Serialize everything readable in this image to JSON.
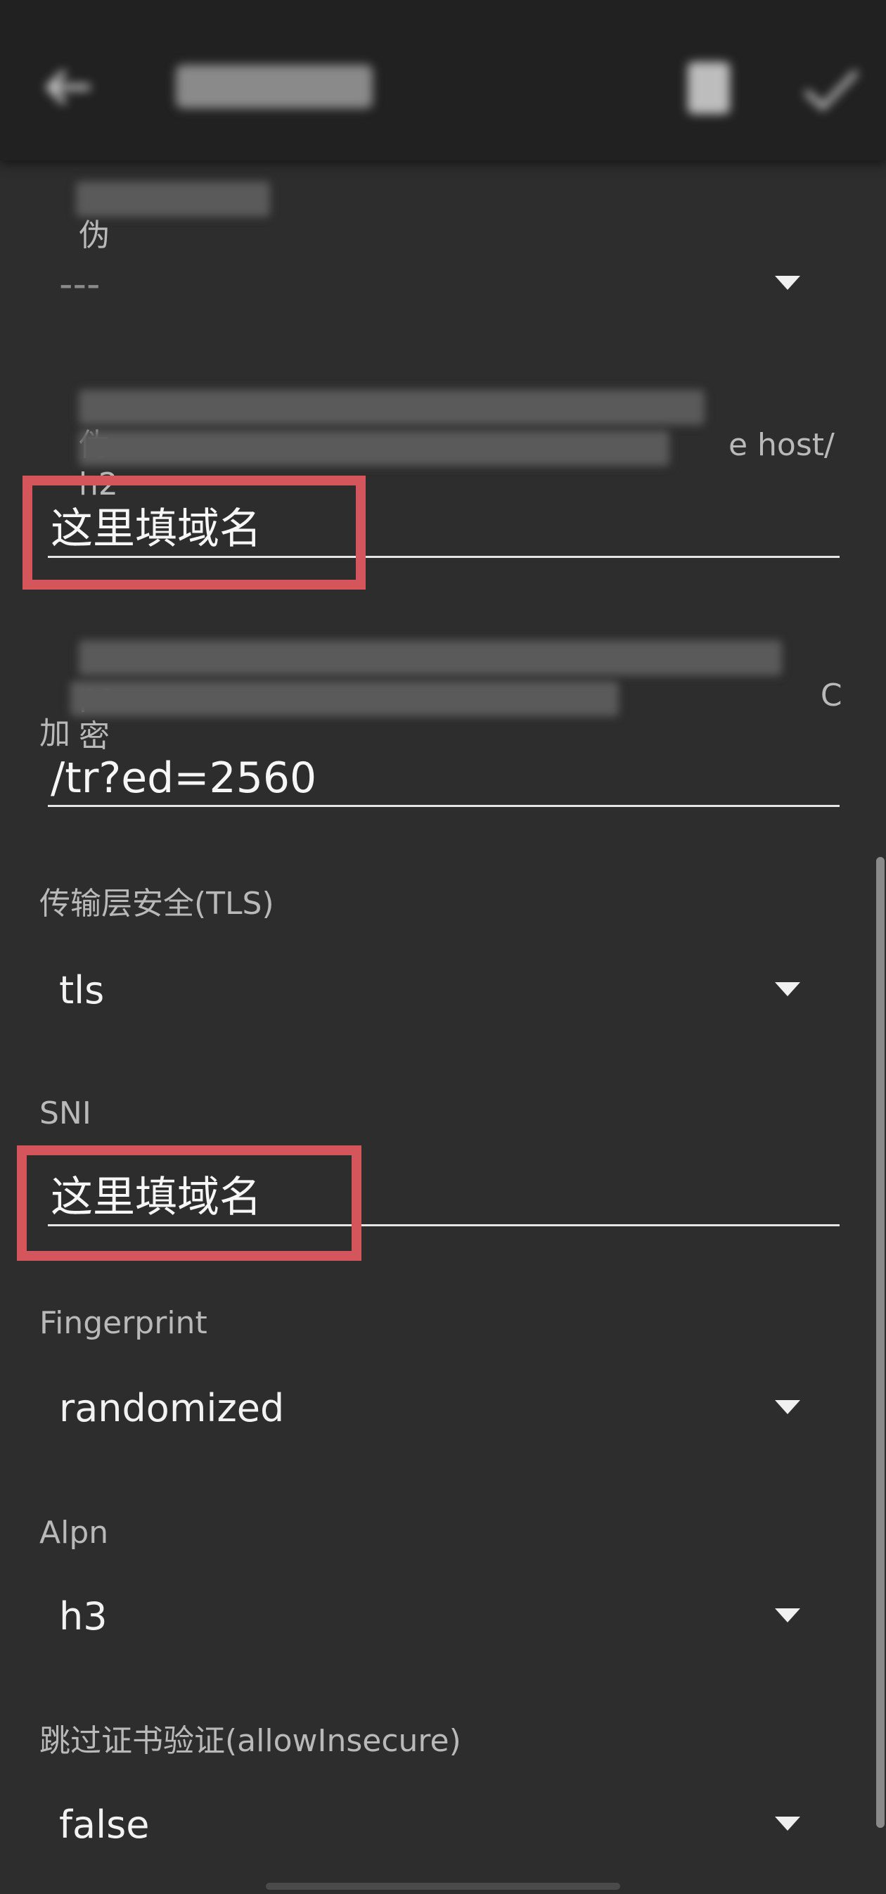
{
  "appbar": {
    "title": ""
  },
  "fields": [
    {
      "label": "伪",
      "value": "---"
    },
    {
      "label": "伪",
      "label_tail": "e host/",
      "label_line2": "h2",
      "value": "这里填域名"
    },
    {
      "label": "pa",
      "label_tail": "C 加",
      "label_line2": "密",
      "value": "/tr?ed=2560"
    },
    {
      "label": "传输层安全(TLS)",
      "value": "tls"
    },
    {
      "label": "SNI",
      "value": "这里填域名"
    },
    {
      "label": "Fingerprint",
      "value": "randomized"
    },
    {
      "label": "Alpn",
      "value": "h3"
    },
    {
      "label": "跳过证书验证(allowInsecure)",
      "value": "false"
    }
  ],
  "colors": {
    "background": "#2d2d2d",
    "appbar": "#212121",
    "highlight": "#d4555b"
  },
  "icons": [
    "back-arrow-icon",
    "document-icon",
    "check-icon",
    "dropdown-caret-icon"
  ]
}
